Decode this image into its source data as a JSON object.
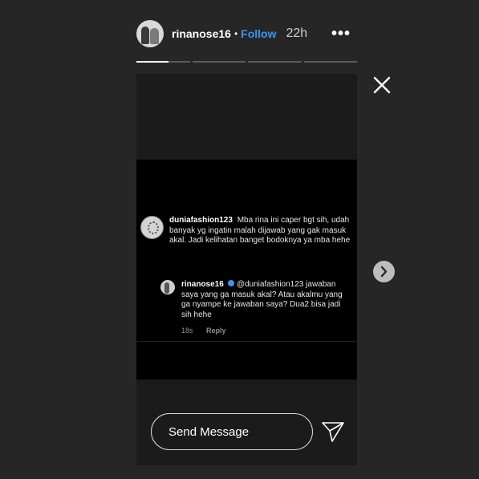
{
  "header": {
    "username": "rinanose16",
    "dot": "•",
    "follow_label": "Follow",
    "time": "22h",
    "more_glyph": "•••"
  },
  "progress": {
    "segments": 4,
    "current_fill": 0.6
  },
  "story": {
    "comment": {
      "username": "duniafashion123",
      "text": "Mba rina ini caper bgt sih, udah banyak yg ingatin malah dijawab yang gak masuk akal. Jadi kelihatan banget bodoknya ya mba hehe"
    },
    "reply": {
      "username": "rinanose16",
      "mention": "@duniafashion123",
      "text": "jawaban saya yang ga masuk akal? Atau akalmu yang ga nyampe ke jawaban saya? Dua2 bisa jadi sih hehe",
      "age": "18s",
      "reply_label": "Reply"
    }
  },
  "composer": {
    "placeholder": "Send Message"
  },
  "icons": {
    "close": "close-icon",
    "send": "send-icon",
    "next": "chevron-right-icon",
    "more": "more-icon",
    "verified": "verified-badge-icon"
  },
  "colors": {
    "background": "#262626",
    "follow": "#3897f0",
    "story_bg": "#1b1b1b"
  }
}
